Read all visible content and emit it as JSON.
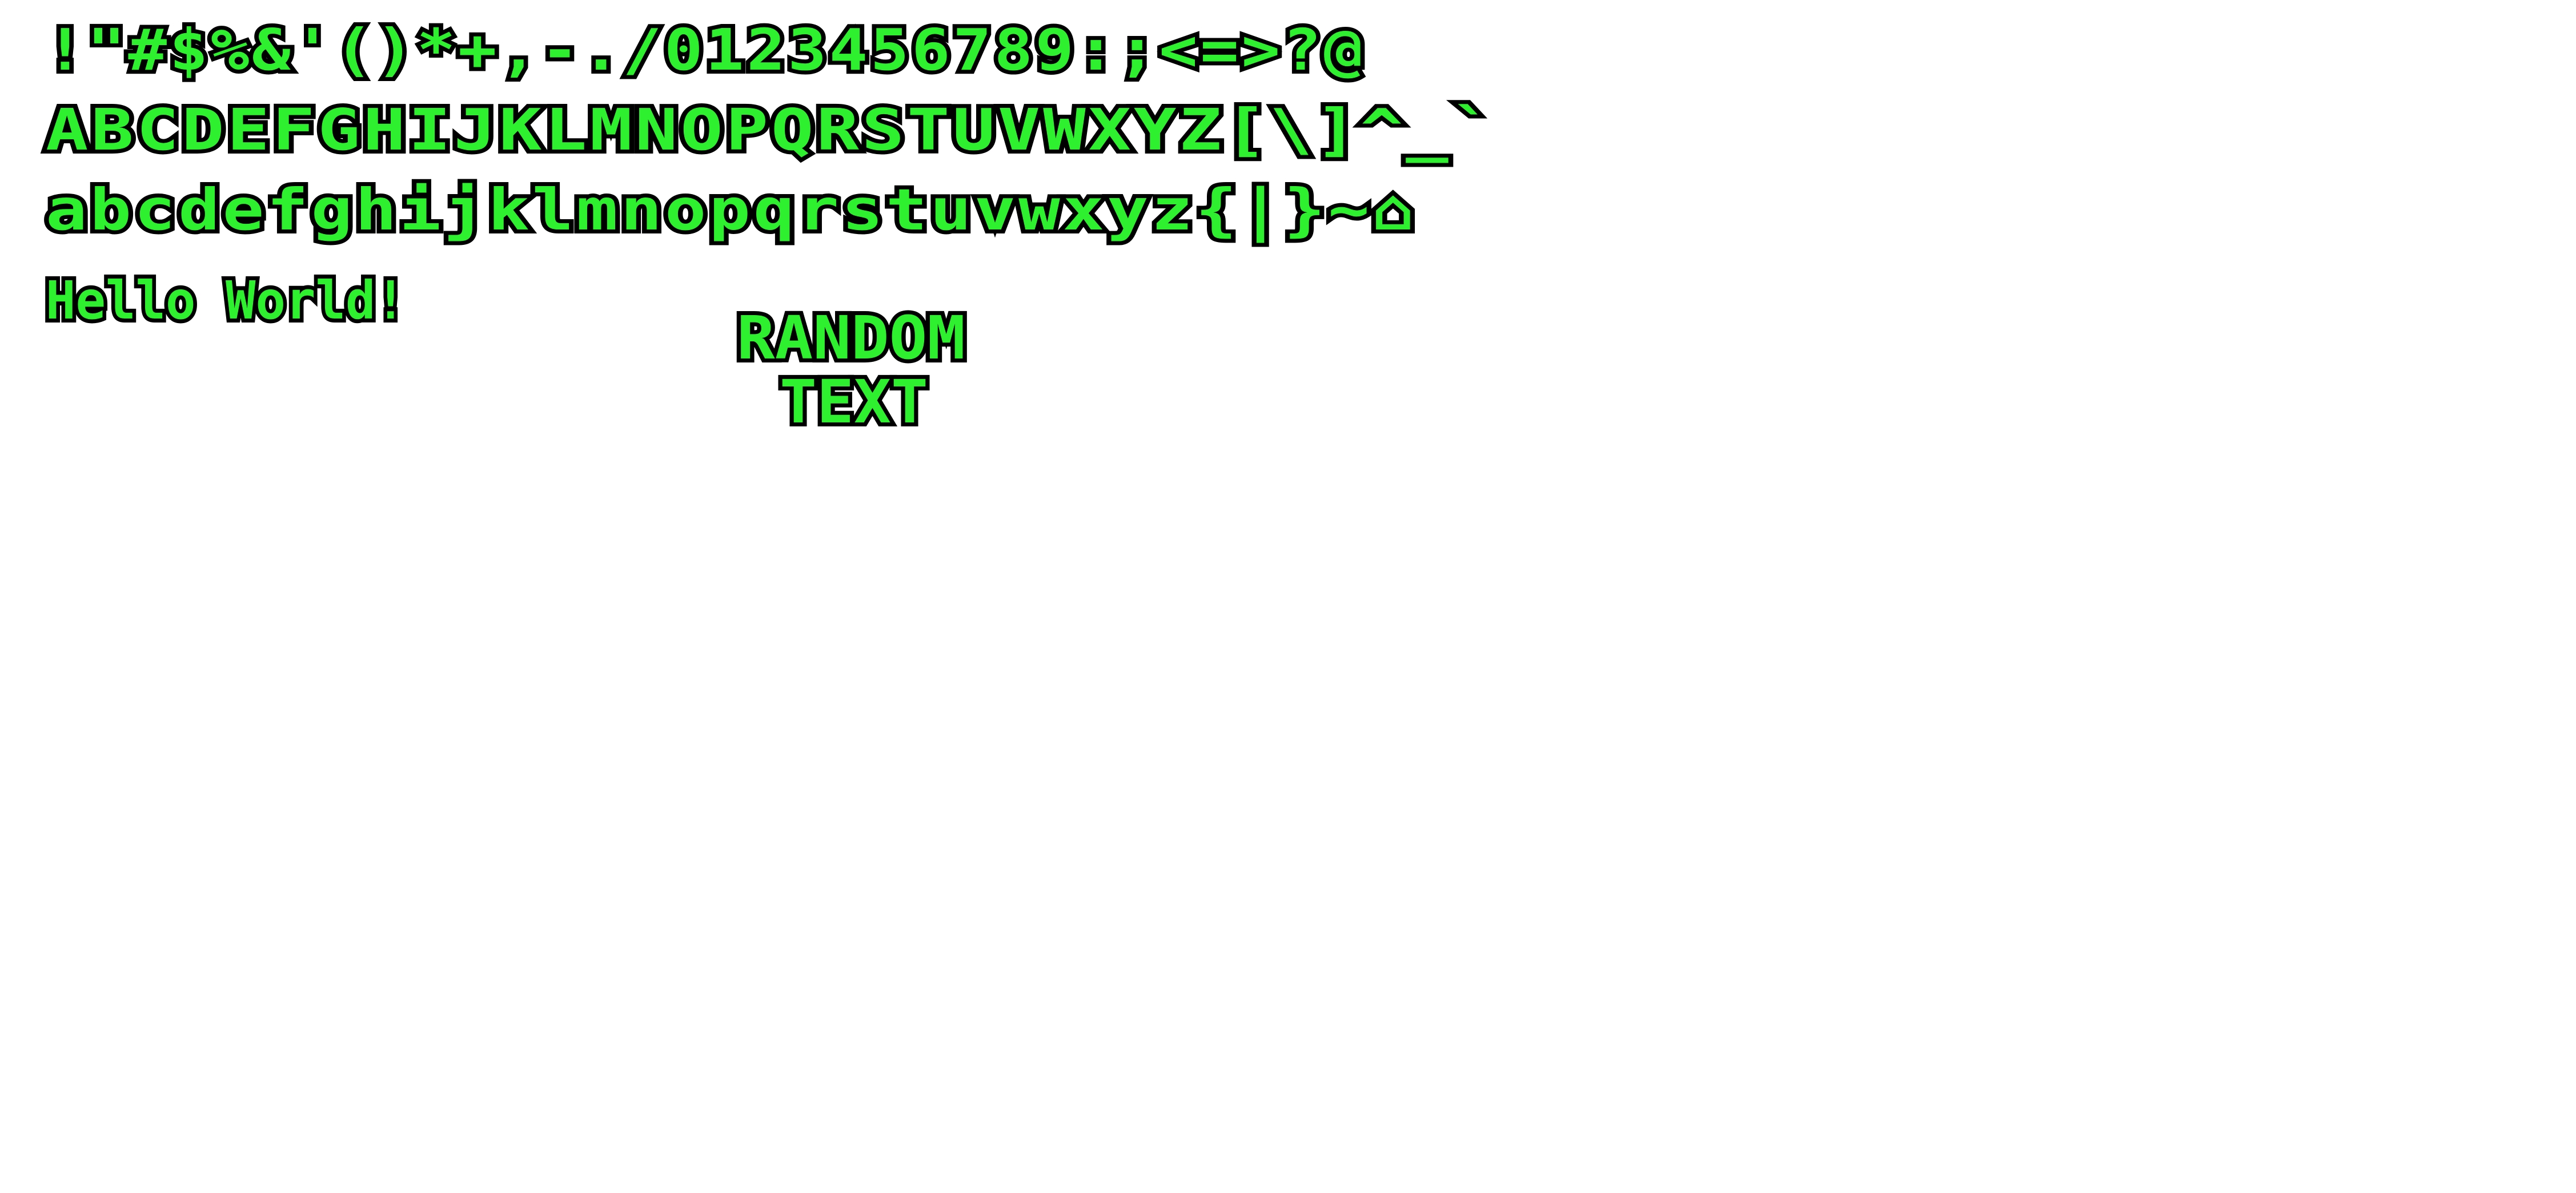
{
  "font_specimen": {
    "row_symbols_digits": "!\"#$%&'()*+,-./0123456789:;<=>?@",
    "row_uppercase": "ABCDEFGHIJKLMNOPQRSTUVWXYZ[\\]^_`",
    "row_lowercase": "abcdefghijklmnopqrstuvwxyz{|}~⌂",
    "sample_text": "Hello World!",
    "random_block": {
      "line_1": "RANDOM",
      "line_2": "TEXT"
    }
  },
  "colors": {
    "glyph_fill": "#2ff02f",
    "glyph_outline": "#000000",
    "background": "#ffffff"
  }
}
